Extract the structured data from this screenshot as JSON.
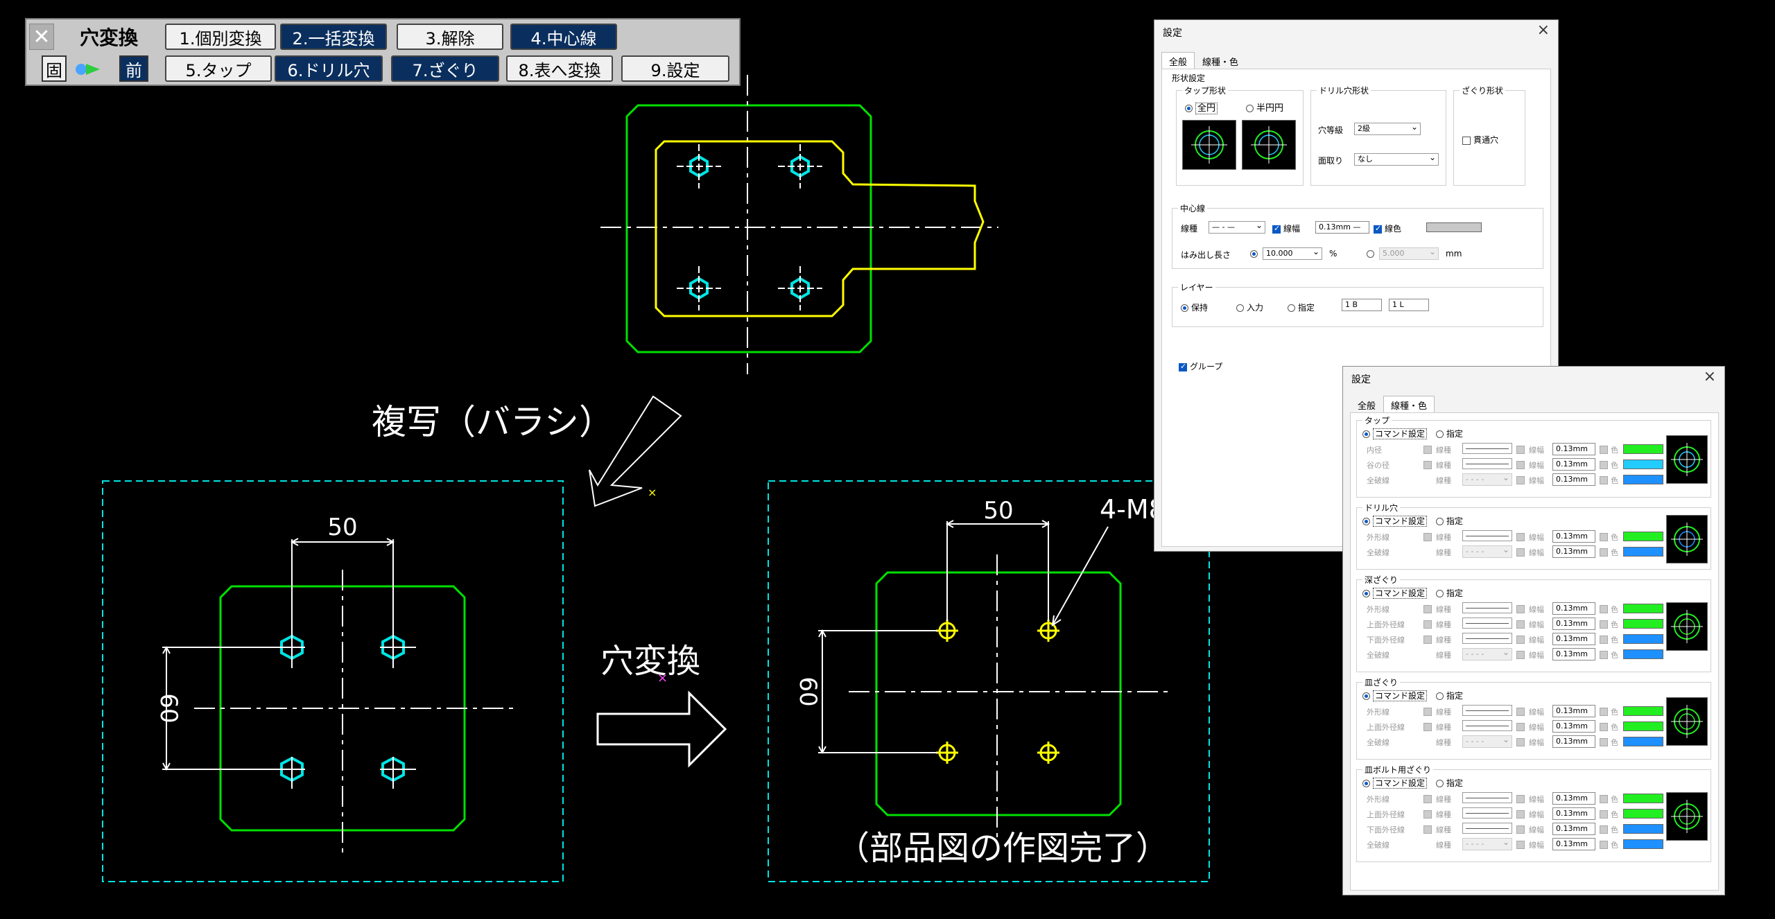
{
  "toolbar": {
    "title": "穴変換",
    "close_label": "✕",
    "fix_label": "固",
    "prev_label": "前",
    "row1": [
      "1.個別変換",
      "2.一括変換",
      "3.解除",
      "4.中心線"
    ],
    "row2": [
      "5.タップ",
      "6.ドリル穴",
      "7.ざぐり",
      "8.表へ変換",
      "9.設定"
    ]
  },
  "drawing": {
    "copy_label": "複写（バラシ）",
    "convert_label": "穴変換",
    "done_label": "（部品図の作図完了）",
    "dim_h_left": "50",
    "dim_v_left": "60",
    "dim_h_right": "50",
    "dim_v_right": "60",
    "callout": "4-M8"
  },
  "dialog1": {
    "title": "設定",
    "tabs": [
      "全般",
      "線種・色"
    ],
    "shape_group": "形状設定",
    "tap_group": "タップ形状",
    "tap_full": "全円",
    "tap_half": "半円円",
    "drill_group": "ドリル穴形状",
    "hole_grade_label": "穴等級",
    "hole_grade_value": "2級",
    "chamfer_label": "面取り",
    "chamfer_value": "なし",
    "counter_group": "ざぐり形状",
    "through_label": "貫通穴",
    "center_group": "中心線",
    "linetype_label": "線種",
    "linetype_value": "— - —",
    "linewidth_label": "線幅",
    "linewidth_value": "0.13mm —",
    "linecolor_label": "線色",
    "overhang_label": "はみ出し長さ",
    "overhang_value": "10.000",
    "percent": "%",
    "overhang_mm_value": "5.000",
    "mm": "mm",
    "layer_group": "レイヤー",
    "layer_keep": "保持",
    "layer_input": "入力",
    "layer_spec": "指定",
    "layer_b": "1 B",
    "layer_l": "1 L",
    "group_label": "グループ"
  },
  "dialog2": {
    "title": "設定",
    "tabs": [
      "全般",
      "線種・色"
    ],
    "cmd_label": "コマンド設定",
    "spec_label": "指定",
    "lt": "線種",
    "lw": "線幅",
    "col": "色",
    "width_value": "0.13mm",
    "sections": [
      {
        "name": "タップ",
        "rows": [
          "内径",
          "谷の径",
          "全破線"
        ],
        "colors": [
          "#22ee22",
          "#22ccff",
          "#1e90ff"
        ]
      },
      {
        "name": "ドリル穴",
        "rows": [
          "外形線",
          "全破線"
        ],
        "colors": [
          "#22ee22",
          "#1e90ff"
        ]
      },
      {
        "name": "深ざぐり",
        "rows": [
          "外形線",
          "上面外径線",
          "下面外径線",
          "全破線"
        ],
        "colors": [
          "#22ee22",
          "#22ee22",
          "#1e90ff",
          "#1e90ff"
        ]
      },
      {
        "name": "皿ざぐり",
        "rows": [
          "外形線",
          "上面外径線",
          "全破線"
        ],
        "colors": [
          "#22ee22",
          "#22ee22",
          "#1e90ff"
        ]
      },
      {
        "name": "皿ボルト用ざぐり",
        "rows": [
          "外形線",
          "上面外径線",
          "下面外径線",
          "全破線"
        ],
        "colors": [
          "#22ee22",
          "#22ee22",
          "#1e90ff",
          "#1e90ff"
        ]
      }
    ]
  },
  "colors": {
    "green": "#00e000",
    "cyan": "#00e5e5",
    "yellow": "#ffff00",
    "navy": "#0a2f5e"
  }
}
